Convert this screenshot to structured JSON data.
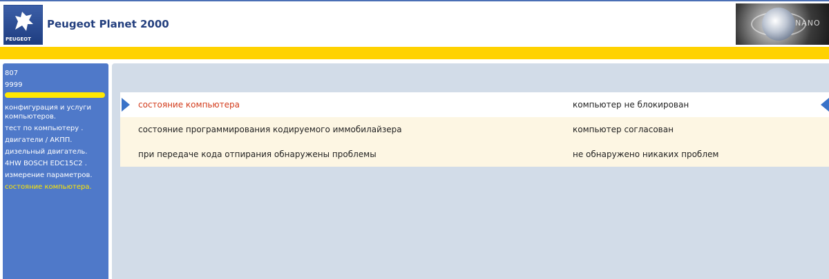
{
  "header": {
    "brand_logo_text": "PEUGEOT",
    "app_title": "Peugeot Planet 2000",
    "banner_text": "NANO"
  },
  "sidebar": {
    "items": [
      {
        "label": "807",
        "state": "normal"
      },
      {
        "label": "9999",
        "state": "normal"
      },
      {
        "label": "",
        "state": "highlighted"
      },
      {
        "label": "конфигурация и услуги компьютеров.",
        "state": "normal"
      },
      {
        "label": "тест по компьютеру .",
        "state": "normal"
      },
      {
        "label": "двигатели / АКПП.",
        "state": "normal"
      },
      {
        "label": "дизельный двигатель.",
        "state": "normal"
      },
      {
        "label": "4HW BOSCH EDC15C2 .",
        "state": "normal"
      },
      {
        "label": "измерение параметров.",
        "state": "normal"
      },
      {
        "label": "состояние компьютера.",
        "state": "active"
      }
    ]
  },
  "main": {
    "rows": [
      {
        "label": "состояние компьютера",
        "value": "компьютер  не блокирован",
        "selected": true
      },
      {
        "label": "состояние программирования кодируемого иммобилайзера",
        "value": "компьютер  согласован",
        "selected": false
      },
      {
        "label": "при передаче кода отпирания обнаружены проблемы",
        "value": "не обнаружено никаких проблем",
        "selected": false
      }
    ]
  },
  "colors": {
    "header_title": "#233f7e",
    "yellow_bar": "#ffd200",
    "sidebar_bg": "#4f79c9",
    "sidebar_active_text": "#ffe800",
    "main_bg": "#d2dce8",
    "selected_label": "#d23a1a",
    "arrow": "#3a73c8"
  },
  "icons": {
    "brand_logo": "peugeot-lion-icon",
    "row_pointer_left": "triangle-right-icon",
    "row_pointer_right": "triangle-left-icon"
  }
}
